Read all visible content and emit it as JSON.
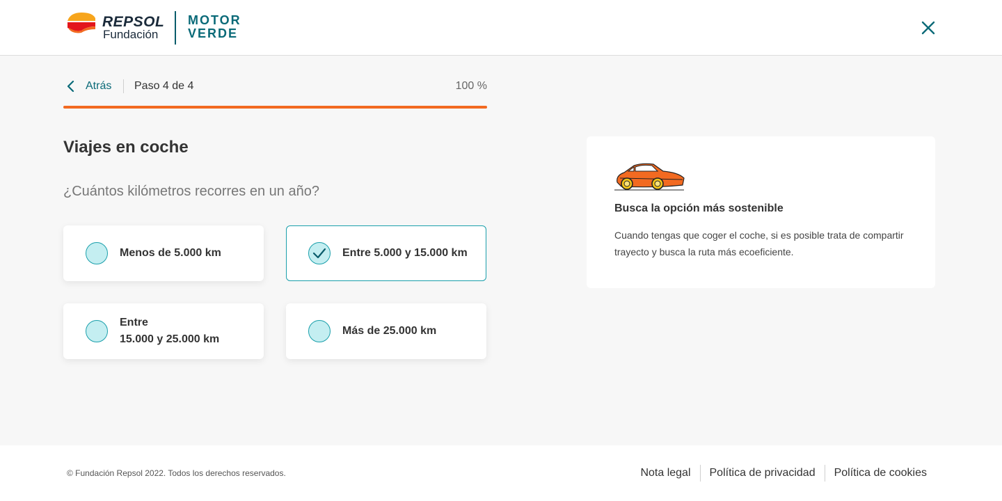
{
  "header": {
    "brand": "REPSOL",
    "brand_sub": "Fundación",
    "program_line1": "MOTOR",
    "program_line2": "VERDE",
    "close_icon": "close-icon"
  },
  "stepper": {
    "back_label": "Atrás",
    "step_text": "Paso 4 de 4",
    "percent_text": "100 %",
    "progress": 1.0
  },
  "section": {
    "title": "Viajes en coche",
    "question": "¿Cuántos kilómetros recorres en un año?"
  },
  "options": [
    {
      "label": "Menos de 5.000 km",
      "selected": false
    },
    {
      "label": "Entre 5.000 y 15.000 km",
      "selected": true
    },
    {
      "label_line1": "Entre",
      "label_line2": "15.000 y 25.000 km",
      "selected": false
    },
    {
      "label": "Más de 25.000 km",
      "selected": false
    }
  ],
  "tip": {
    "icon": "car-icon",
    "title": "Busca la opción más sostenible",
    "text": "Cuando tengas que coger el coche, si es posible trata de compartir trayecto y busca la ruta más ecoeficiente."
  },
  "footer": {
    "copyright": "© Fundación Repsol 2022. Todos los derechos reservados.",
    "links": [
      "Nota legal",
      "Política de privacidad",
      "Política de cookies"
    ]
  },
  "colors": {
    "accent": "#0a6a78",
    "progress": "#f26a21",
    "radio_fill": "#c4eef1",
    "selected_border": "#1a9fab"
  }
}
